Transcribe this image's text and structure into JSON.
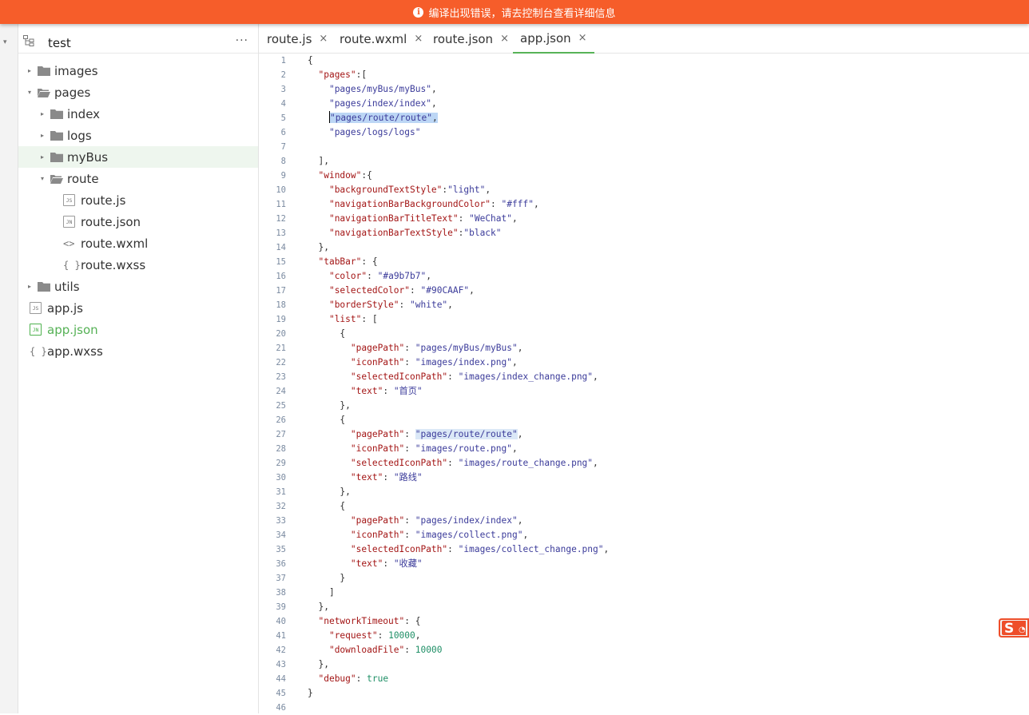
{
  "error_bar": {
    "message": "编译出现错误，请去控制台查看详细信息",
    "color": "#f65d2a"
  },
  "sidebar": {
    "project_name": "test",
    "more_label": "···",
    "tree": [
      {
        "label": "images",
        "kind": "folder",
        "depth": 0,
        "expanded": false
      },
      {
        "label": "pages",
        "kind": "folder",
        "depth": 0,
        "expanded": true
      },
      {
        "label": "index",
        "kind": "folder",
        "depth": 1,
        "expanded": false
      },
      {
        "label": "logs",
        "kind": "folder",
        "depth": 1,
        "expanded": false
      },
      {
        "label": "myBus",
        "kind": "folder",
        "depth": 1,
        "expanded": false,
        "selected": true
      },
      {
        "label": "route",
        "kind": "folder",
        "depth": 1,
        "expanded": true
      },
      {
        "label": "route.js",
        "kind": "js",
        "depth": 2,
        "badge": "JS"
      },
      {
        "label": "route.json",
        "kind": "json",
        "depth": 2,
        "badge": "JN"
      },
      {
        "label": "route.wxml",
        "kind": "wxml",
        "depth": 2,
        "badge": "<>"
      },
      {
        "label": "route.wxss",
        "kind": "wxss",
        "depth": 2,
        "badge": "{ }"
      },
      {
        "label": "utils",
        "kind": "folder",
        "depth": 0,
        "expanded": false
      },
      {
        "label": "app.js",
        "kind": "js",
        "depth": 0,
        "badge": "JS"
      },
      {
        "label": "app.json",
        "kind": "json",
        "depth": 0,
        "badge": "JN",
        "active": true
      },
      {
        "label": "app.wxss",
        "kind": "wxss",
        "depth": 0,
        "badge": "{ }"
      }
    ]
  },
  "tabs": [
    {
      "label": "route.js",
      "close": "×"
    },
    {
      "label": "route.wxml",
      "close": "×"
    },
    {
      "label": "route.json",
      "close": "×"
    },
    {
      "label": "app.json",
      "close": "×",
      "active": true
    }
  ],
  "code_lines": [
    "{",
    "  \"pages\":[",
    "    \"pages/myBus/myBus\",",
    "    \"pages/index/index\",",
    "    \"pages/route/route\",",
    "    \"pages/logs/logs\"",
    "",
    "  ],",
    "  \"window\":{",
    "    \"backgroundTextStyle\":\"light\",",
    "    \"navigationBarBackgroundColor\": \"#fff\",",
    "    \"navigationBarTitleText\": \"WeChat\",",
    "    \"navigationBarTextStyle\":\"black\"",
    "  },",
    "  \"tabBar\": {",
    "    \"color\": \"#a9b7b7\",",
    "    \"selectedColor\": \"#90CAAF\",",
    "    \"borderStyle\": \"white\",",
    "    \"list\": [",
    "      {",
    "        \"pagePath\": \"pages/myBus/myBus\",",
    "        \"iconPath\": \"images/index.png\",",
    "        \"selectedIconPath\": \"images/index_change.png\",",
    "        \"text\": \"首页\"",
    "      },",
    "      {",
    "        \"pagePath\": \"pages/route/route\",",
    "        \"iconPath\": \"images/route.png\",",
    "        \"selectedIconPath\": \"images/route_change.png\",",
    "        \"text\": \"路线\"",
    "      },",
    "      {",
    "        \"pagePath\": \"pages/index/index\",",
    "        \"iconPath\": \"images/collect.png\",",
    "        \"selectedIconPath\": \"images/collect_change.png\",",
    "        \"text\": \"收藏\"",
    "      }",
    "    ]",
    "  },",
    "  \"networkTimeout\": {",
    "    \"request\": 10000,",
    "    \"downloadFile\": 10000",
    "  },",
    "  \"debug\": true",
    "}",
    ""
  ],
  "highlights": {
    "selection_line": 5,
    "match_line": 27,
    "match_text": "\"pages/route/route\""
  },
  "colors": {
    "accent_green": "#57b357",
    "selection": "#bcd6f5",
    "key": "#a31515",
    "string": "#3b3b9a",
    "number": "#1f8f66"
  },
  "icons": {
    "error": "info-circle-icon",
    "tree": "file-tree-icon",
    "folder": "folder-icon",
    "sogou": "sogou-ime-icon"
  }
}
